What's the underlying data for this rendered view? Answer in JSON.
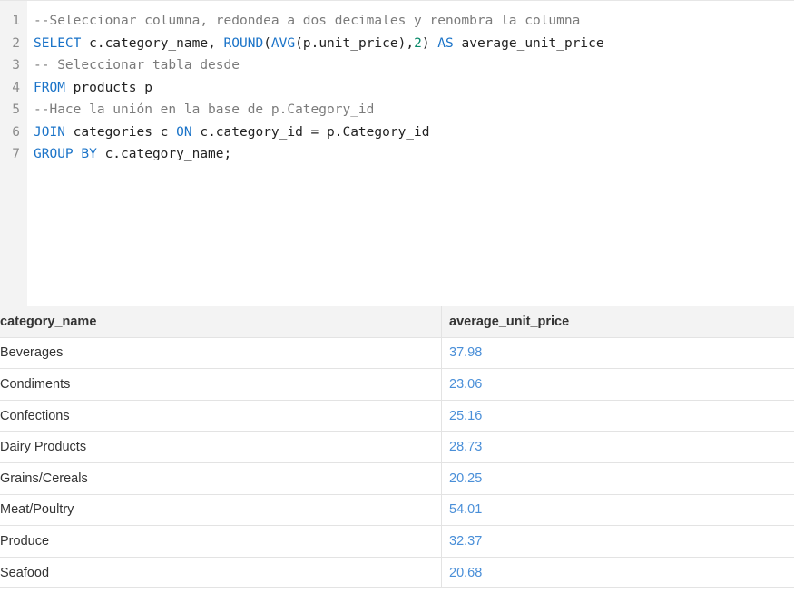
{
  "editor": {
    "lines": [
      {
        "num": "1",
        "tokens": [
          {
            "t": "--Seleccionar columna, redondea a dos decimales y renombra la columna",
            "k": "comment"
          }
        ]
      },
      {
        "num": "2",
        "tokens": [
          {
            "t": "SELECT",
            "k": "keyword"
          },
          {
            "t": " c.category_name, ",
            "k": "text"
          },
          {
            "t": "ROUND",
            "k": "keyword"
          },
          {
            "t": "(",
            "k": "text"
          },
          {
            "t": "AVG",
            "k": "keyword"
          },
          {
            "t": "(p.unit_price),",
            "k": "text"
          },
          {
            "t": "2",
            "k": "number"
          },
          {
            "t": ") ",
            "k": "text"
          },
          {
            "t": "AS",
            "k": "keyword"
          },
          {
            "t": " average_unit_price",
            "k": "text"
          }
        ]
      },
      {
        "num": "3",
        "tokens": [
          {
            "t": "-- Seleccionar tabla desde",
            "k": "comment"
          }
        ]
      },
      {
        "num": "4",
        "tokens": [
          {
            "t": "FROM",
            "k": "keyword"
          },
          {
            "t": " products p",
            "k": "text"
          }
        ]
      },
      {
        "num": "5",
        "tokens": [
          {
            "t": "--Hace la unión en la base de p.Category_id",
            "k": "comment"
          }
        ]
      },
      {
        "num": "6",
        "tokens": [
          {
            "t": "JOIN",
            "k": "keyword"
          },
          {
            "t": " categories c ",
            "k": "text"
          },
          {
            "t": "ON",
            "k": "keyword"
          },
          {
            "t": " c.category_id = p.Category_id",
            "k": "text"
          }
        ]
      },
      {
        "num": "7",
        "tokens": [
          {
            "t": "GROUP BY",
            "k": "keyword"
          },
          {
            "t": " c.category_name;",
            "k": "text"
          }
        ]
      }
    ]
  },
  "results": {
    "columns": [
      "category_name",
      "average_unit_price"
    ],
    "rows": [
      [
        "Beverages",
        "37.98"
      ],
      [
        "Condiments",
        "23.06"
      ],
      [
        "Confections",
        "25.16"
      ],
      [
        "Dairy Products",
        "28.73"
      ],
      [
        "Grains/Cereals",
        "20.25"
      ],
      [
        "Meat/Poultry",
        "54.01"
      ],
      [
        "Produce",
        "32.37"
      ],
      [
        "Seafood",
        "20.68"
      ]
    ]
  }
}
